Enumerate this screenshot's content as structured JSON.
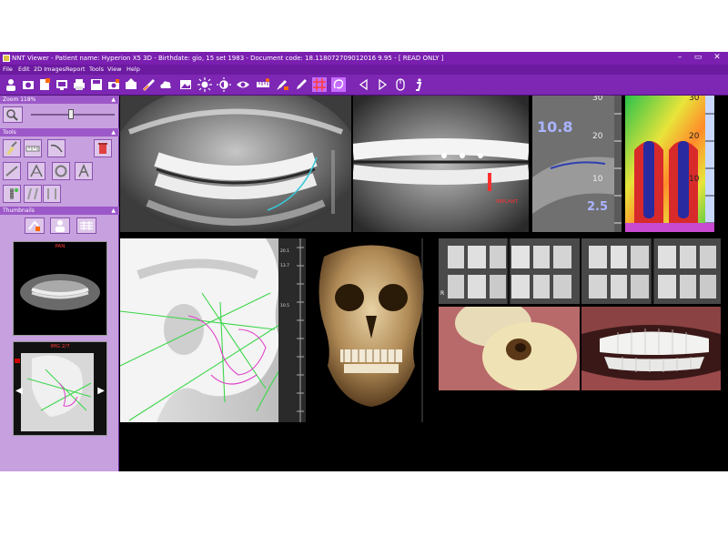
{
  "window": {
    "title": "NNT Viewer - Patient name: Hyperion X5 3D - Birthdate: gio, 15 set 1983 - Document code: 18.118072709012016 9.95 - [ READ ONLY ]",
    "controls": [
      "–",
      "▭",
      "✕"
    ]
  },
  "menu": [
    "File",
    "Edit",
    "2D Images",
    "Report",
    "Tools",
    "View",
    "Help"
  ],
  "toolbar": {
    "icons": [
      "patient-icon",
      "acquire-icon",
      "new-image-icon",
      "tv-icon",
      "printer-icon",
      "save-icon",
      "camera-icon",
      "export-icon",
      "ruler-icon",
      "cloud-icon",
      "image-icon",
      "brightness-icon",
      "contrast-icon",
      "eye-icon",
      "measure-icon",
      "annotate-icon",
      "pen-icon",
      "grid-icon",
      "lasso-icon",
      "prev-icon",
      "next-icon",
      "mouse-icon",
      "info-icon"
    ],
    "accent": "#ff6a00"
  },
  "left_panel": {
    "zoom": {
      "label": "Zoom 118%",
      "slider_fraction": 0.48
    },
    "tools_label": "Tools",
    "thumbnails_label": "Thumbnails",
    "thumbnails": [
      {
        "caption": "PAN"
      },
      {
        "caption": "IMG 2/7"
      }
    ]
  },
  "viewer": {
    "implant_label": "IMPLANT",
    "ceph_ticks": [
      "20.1",
      "13.7",
      "10.5"
    ],
    "cross_section": {
      "big": "10.8",
      "small": "2.5",
      "scale": [
        "30",
        "20",
        "10"
      ]
    },
    "heatmap_scale": [
      "30",
      "20",
      "10"
    ],
    "bitewing_marker": "R"
  },
  "colors": {
    "title_bar": "#7a1fb0",
    "panel": "#c7a0df",
    "section_header": "#9c58c8",
    "ceph_green": "#3cd64a",
    "ceph_magenta": "#e040c8",
    "nerve_cyan": "#38c8d8"
  }
}
